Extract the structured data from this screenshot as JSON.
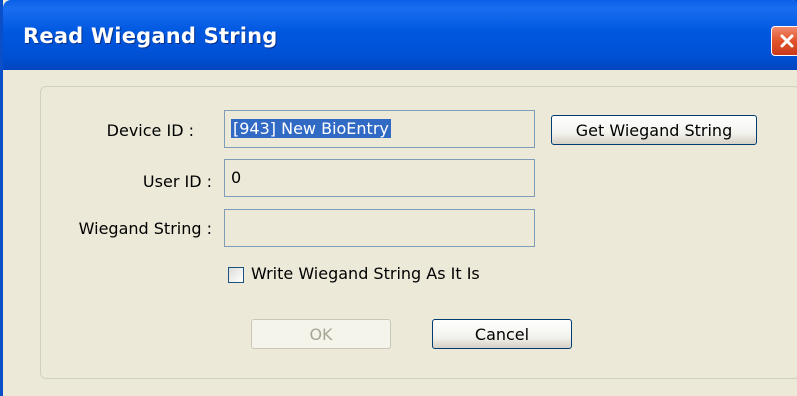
{
  "window": {
    "title": "Read Wiegand String"
  },
  "form": {
    "device_id_label": "Device ID :",
    "device_id_value": "[943] New BioEntry",
    "user_id_label": "User ID :",
    "user_id_value": "0",
    "wiegand_string_label": "Wiegand String :",
    "wiegand_string_value": "",
    "write_as_is_label": "Write Wiegand String As It Is",
    "write_as_is_checked": false
  },
  "buttons": {
    "get_wiegand": "Get Wiegand String",
    "ok": "OK",
    "cancel": "Cancel"
  },
  "icons": {
    "close": "close-icon"
  },
  "colors": {
    "titlebar": "#0058e0",
    "close": "#e2532b",
    "selection": "#316ac5",
    "dialog_bg": "#ece9d8"
  }
}
